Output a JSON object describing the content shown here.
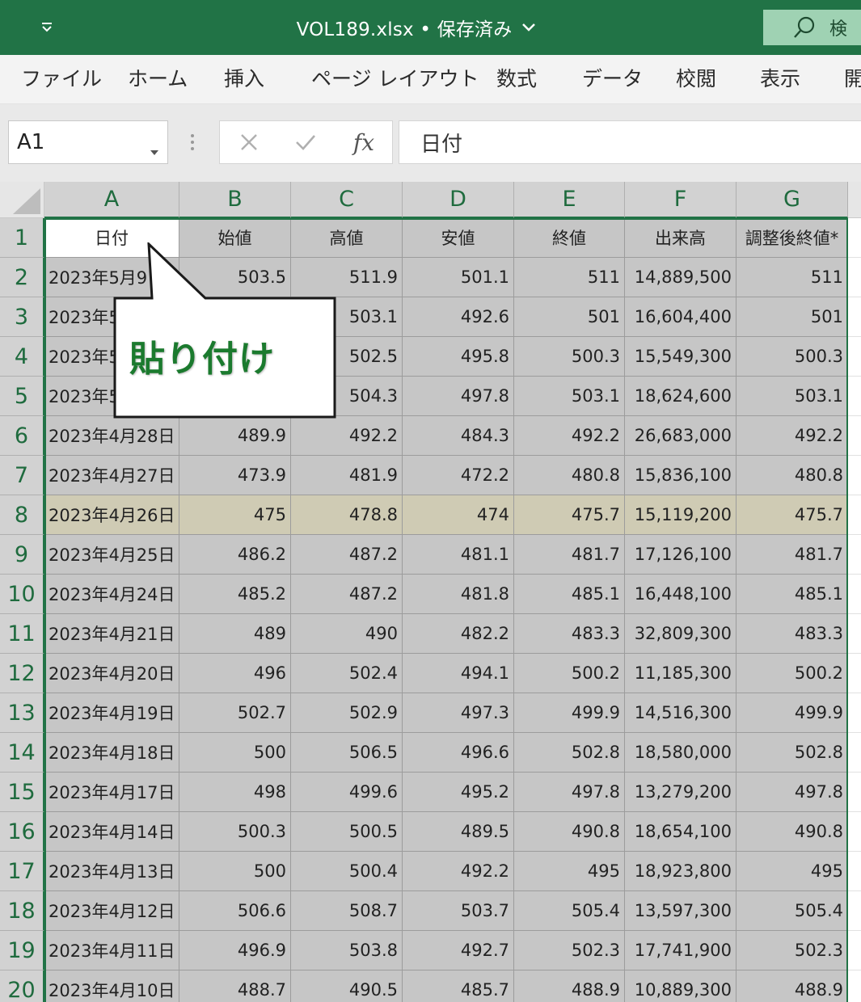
{
  "window": {
    "doc_title": "VOL189.xlsx • 保存済み",
    "search_label": "検"
  },
  "ribbon": {
    "tabs": [
      "ファイル",
      "ホーム",
      "挿入",
      "ページ レイアウト",
      "数式",
      "データ",
      "校閲",
      "表示",
      "開"
    ]
  },
  "formula_bar": {
    "name_box": "A1",
    "fx": "fx",
    "formula": "日付"
  },
  "sheet": {
    "columns": [
      "A",
      "B",
      "C",
      "D",
      "E",
      "F",
      "G"
    ],
    "row_numbers": [
      "1",
      "2",
      "3",
      "4",
      "5",
      "6",
      "7",
      "8",
      "9",
      "10",
      "11",
      "12",
      "13",
      "14",
      "15",
      "16",
      "17",
      "18",
      "19",
      "20"
    ],
    "header": [
      "日付",
      "始値",
      "高値",
      "安値",
      "終値",
      "出来高",
      "調整後終値*"
    ],
    "rows": [
      [
        "2023年5月9日",
        "503.5",
        "511.9",
        "501.1",
        "511",
        "14,889,500",
        "511"
      ],
      [
        "2023年5月8日",
        "",
        "503.1",
        "492.6",
        "501",
        "16,604,400",
        "501"
      ],
      [
        "2023年5月2日",
        "",
        "502.5",
        "495.8",
        "500.3",
        "15,549,300",
        "500.3"
      ],
      [
        "2023年5月1日",
        "",
        "504.3",
        "497.8",
        "503.1",
        "18,624,600",
        "503.1"
      ],
      [
        "2023年4月28日",
        "489.9",
        "492.2",
        "484.3",
        "492.2",
        "26,683,000",
        "492.2"
      ],
      [
        "2023年4月27日",
        "473.9",
        "481.9",
        "472.2",
        "480.8",
        "15,836,100",
        "480.8"
      ],
      [
        "2023年4月26日",
        "475",
        "478.8",
        "474",
        "475.7",
        "15,119,200",
        "475.7"
      ],
      [
        "2023年4月25日",
        "486.2",
        "487.2",
        "481.1",
        "481.7",
        "17,126,100",
        "481.7"
      ],
      [
        "2023年4月24日",
        "485.2",
        "487.2",
        "481.8",
        "485.1",
        "16,448,100",
        "485.1"
      ],
      [
        "2023年4月21日",
        "489",
        "490",
        "482.2",
        "483.3",
        "32,809,300",
        "483.3"
      ],
      [
        "2023年4月20日",
        "496",
        "502.4",
        "494.1",
        "500.2",
        "11,185,300",
        "500.2"
      ],
      [
        "2023年4月19日",
        "502.7",
        "502.9",
        "497.3",
        "499.9",
        "14,516,300",
        "499.9"
      ],
      [
        "2023年4月18日",
        "500",
        "506.5",
        "496.6",
        "502.8",
        "18,580,000",
        "502.8"
      ],
      [
        "2023年4月17日",
        "498",
        "499.6",
        "495.2",
        "497.8",
        "13,279,200",
        "497.8"
      ],
      [
        "2023年4月14日",
        "500.3",
        "500.5",
        "489.5",
        "490.8",
        "18,654,100",
        "490.8"
      ],
      [
        "2023年4月13日",
        "500",
        "500.4",
        "492.2",
        "495",
        "18,923,800",
        "495"
      ],
      [
        "2023年4月12日",
        "506.6",
        "508.7",
        "503.7",
        "505.4",
        "13,597,300",
        "505.4"
      ],
      [
        "2023年4月11日",
        "496.9",
        "503.8",
        "492.7",
        "502.3",
        "17,741,900",
        "502.3"
      ],
      [
        "2023年4月10日",
        "488.7",
        "490.5",
        "485.7",
        "488.9",
        "10,889,300",
        "488.9"
      ]
    ],
    "highlighted_row": 8
  },
  "callout": {
    "text": "貼り付け",
    "color": "#1b7a2e"
  },
  "colors": {
    "excel_green": "#217346",
    "selection_fill": "#c6c6c6",
    "highlight_row_fill": "#cfcbb4"
  }
}
